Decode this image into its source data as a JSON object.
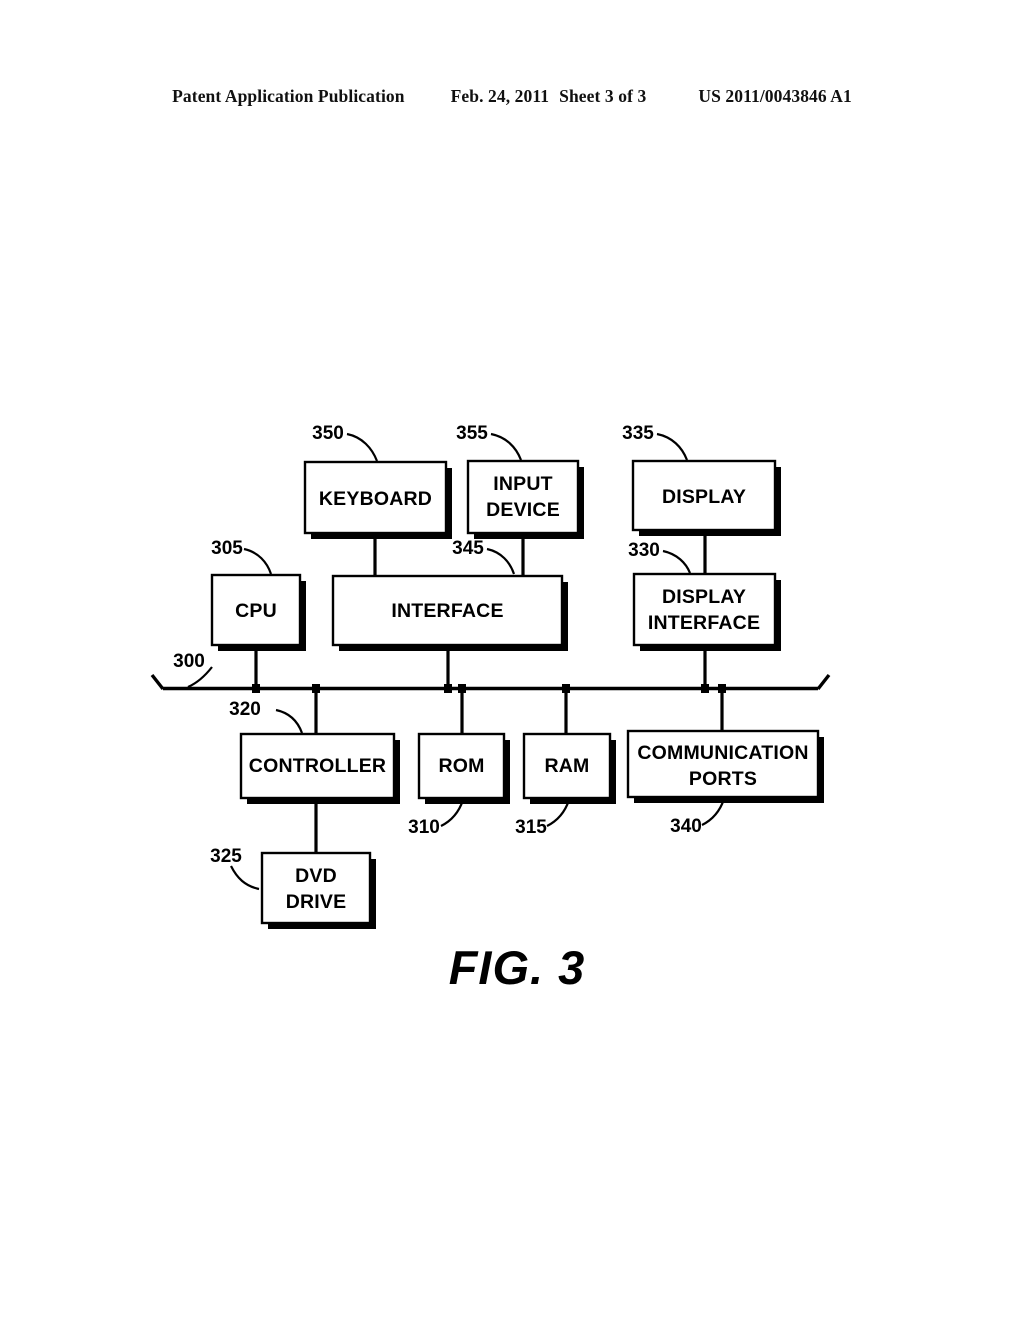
{
  "header": {
    "publication": "Patent Application Publication",
    "date": "Feb. 24, 2011",
    "sheet": "Sheet 3 of 3",
    "document_number": "US 2011/0043846 A1"
  },
  "figure": {
    "caption": "FIG. 3",
    "bus_label": "300",
    "nodes": [
      {
        "id": "keyboard",
        "ref": "350",
        "line1": "KEYBOARD",
        "line2": ""
      },
      {
        "id": "input-device",
        "ref": "355",
        "line1": "INPUT",
        "line2": "DEVICE"
      },
      {
        "id": "display",
        "ref": "335",
        "line1": "DISPLAY",
        "line2": ""
      },
      {
        "id": "cpu",
        "ref": "305",
        "line1": "CPU",
        "line2": ""
      },
      {
        "id": "interface",
        "ref": "345",
        "line1": "INTERFACE",
        "line2": ""
      },
      {
        "id": "display-interface",
        "ref": "330",
        "line1": "DISPLAY",
        "line2": "INTERFACE"
      },
      {
        "id": "controller",
        "ref": "320",
        "line1": "CONTROLLER",
        "line2": ""
      },
      {
        "id": "rom",
        "ref": "310",
        "line1": "ROM",
        "line2": ""
      },
      {
        "id": "ram",
        "ref": "315",
        "line1": "RAM",
        "line2": ""
      },
      {
        "id": "communication-ports",
        "ref": "340",
        "line1": "COMMUNICATION",
        "line2": "PORTS"
      },
      {
        "id": "dvd-drive",
        "ref": "325",
        "line1": "DVD",
        "line2": "DRIVE"
      }
    ]
  },
  "colors": {
    "ink": "#000000",
    "paper": "#ffffff"
  }
}
